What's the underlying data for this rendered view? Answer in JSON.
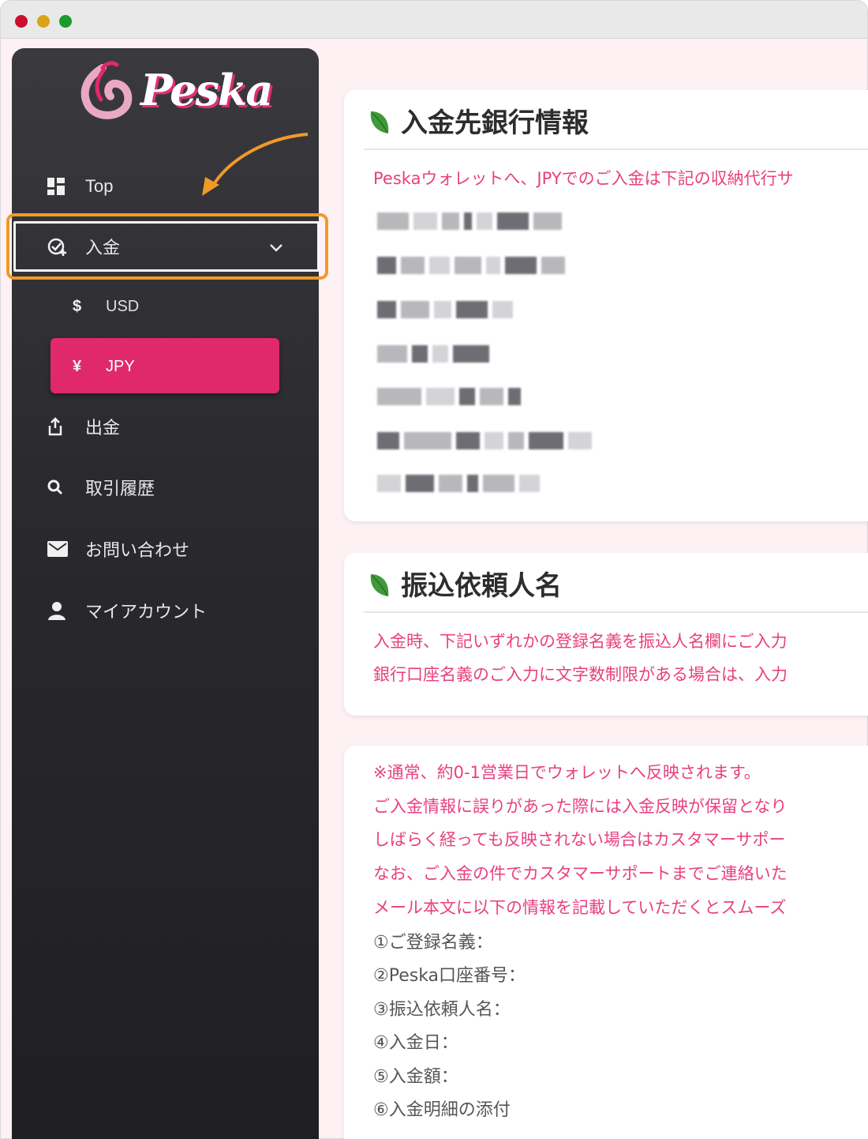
{
  "sidebar": {
    "logo_text": "Peska",
    "items": [
      {
        "label": "Top",
        "icon": "dashboard-icon"
      },
      {
        "label": "入金",
        "icon": "deposit-icon"
      },
      {
        "label": "出金",
        "icon": "withdraw-icon"
      },
      {
        "label": "取引履歴",
        "icon": "search-icon"
      },
      {
        "label": "お問い合わせ",
        "icon": "mail-icon"
      },
      {
        "label": "マイアカウント",
        "icon": "user-icon"
      }
    ],
    "sub_items": [
      {
        "label": "USD",
        "icon": "$"
      },
      {
        "label": "JPY",
        "icon": "¥"
      }
    ]
  },
  "bank_info": {
    "title": "入金先銀行情報",
    "intro": "Peskaウォレットへ、JPYでのご入金は下記の収納代行サ"
  },
  "sender_name": {
    "title": "振込依頼人名",
    "lines": [
      "入金時、下記いずれかの登録名義を振込人名欄にご入力",
      "銀行口座名義のご入力に文字数制限がある場合は、入力"
    ]
  },
  "notes": {
    "pink_lines": [
      "※通常、約0-1営業日でウォレットへ反映されます。",
      "ご入金情報に誤りがあった際には入金反映が保留となり",
      "しばらく経っても反映されない場合はカスタマーサポー",
      "なお、ご入金の件でカスタマーサポートまでご連絡いた",
      "メール本文に以下の情報を記載していただくとスムーズ"
    ],
    "list": [
      "①ご登録名義：",
      "②Peska口座番号：",
      "③振込依頼人名：",
      "④入金日：",
      "⑤入金額：",
      "⑥入金明細の添付"
    ]
  },
  "colors": {
    "accent": "#e0296b",
    "highlight": "#f09a28",
    "pink_text": "#e8407f"
  }
}
